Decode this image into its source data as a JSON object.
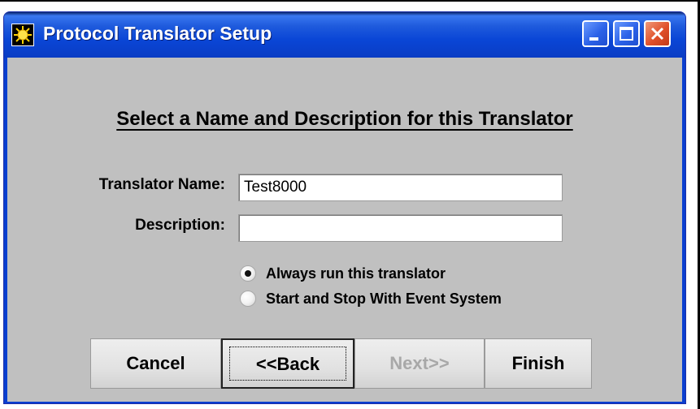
{
  "window": {
    "title": "Protocol Translator Setup",
    "icon": "sun-burst-icon",
    "controls": {
      "minimize": "minimize-icon",
      "maximize": "maximize-icon",
      "close": "close-icon"
    }
  },
  "dialog": {
    "heading": "Select a Name and Description for this Translator",
    "fields": {
      "name_label": "Translator Name:",
      "name_value": "Test8000",
      "description_label": "Description:",
      "description_value": ""
    },
    "run_mode": {
      "options": [
        "Always run this translator",
        "Start and Stop With Event System"
      ],
      "selected": "Always run this translator"
    },
    "buttons": {
      "cancel": "Cancel",
      "back": "<<Back",
      "next": "Next>>",
      "next_enabled": false,
      "finish": "Finish"
    }
  },
  "colors": {
    "titlebar": "#0a46d6",
    "client": "#c0c0c0",
    "close_button": "#e0502a"
  }
}
